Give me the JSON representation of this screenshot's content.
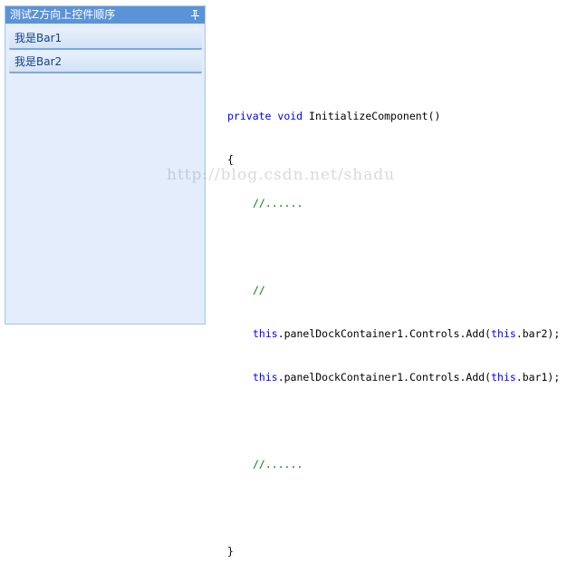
{
  "panel": {
    "title": "测试Z方向上控件顺序",
    "bars": [
      {
        "label": "我是Bar1"
      },
      {
        "label": "我是Bar2"
      }
    ]
  },
  "code": {
    "signature": {
      "kw1": "private",
      "kw2": "void",
      "name": "InitializeComponent()"
    },
    "open_brace": "{",
    "comment_ellipsis_1": "//......",
    "comment_empty": "//",
    "line_add_bar2": {
      "kw": "this",
      "mid": ".panelDockContainer1.Controls.Add(",
      "kw2": "this",
      "tail": ".bar2);"
    },
    "line_add_bar1": {
      "kw": "this",
      "mid": ".panelDockContainer1.Controls.Add(",
      "kw2": "this",
      "tail": ".bar1);"
    },
    "comment_ellipsis_2": "//......",
    "close_brace": "}"
  },
  "watermark": "http://blog.csdn.net/shadu",
  "colors": {
    "title_bar": "#5b93d8",
    "panel_bg": "#e3edfb",
    "bar_text": "#15428b",
    "keyword": "#0000ff",
    "comment": "#008000"
  },
  "icons": {
    "pin": "pin-icon"
  }
}
